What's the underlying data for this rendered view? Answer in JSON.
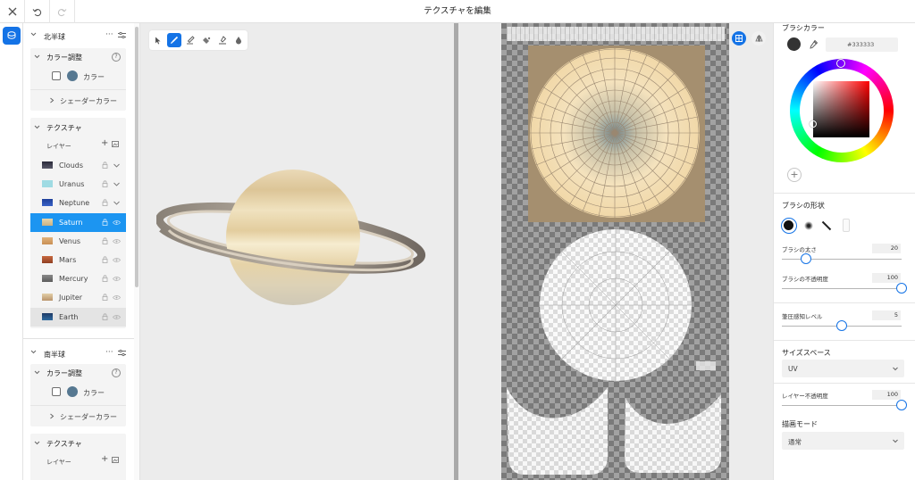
{
  "app": {
    "title": "テクスチャを編集"
  },
  "left": {
    "north": {
      "label": "北半球",
      "color_adjust": "カラー調整",
      "color_label": "カラー",
      "shader_color": "シェーダーカラー",
      "texture": "テクスチャ",
      "layer_label": "レイヤー",
      "layers": [
        "Clouds",
        "Uranus",
        "Neptune",
        "Saturn",
        "Venus",
        "Mars",
        "Mercury",
        "Jupiter",
        "Earth"
      ]
    },
    "south": {
      "label": "南半球",
      "color_adjust": "カラー調整",
      "color_label": "カラー",
      "shader_color": "シェーダーカラー",
      "texture": "テクスチャ",
      "layer_label": "レイヤー"
    },
    "swatch_color": "#567891",
    "selected_layer": "Saturn"
  },
  "right": {
    "brush_color_label": "ブラシカラー",
    "hex": "#333333",
    "brush_shape_label": "ブラシの形状",
    "brush_size_label": "ブラシの太さ",
    "brush_size": "20",
    "brush_opacity_label": "ブラシの不透明度",
    "brush_opacity": "100",
    "pressure_label": "筆圧感知レベル",
    "pressure": "5",
    "size_space_label": "サイズスペース",
    "size_space": "UV",
    "layer_opacity_label": "レイヤー不透明度",
    "layer_opacity": "100",
    "draw_mode_label": "描画モード",
    "draw_mode": "通常",
    "brush_size_fraction": 0.2,
    "brush_opacity_fraction": 1.0,
    "pressure_fraction": 0.5,
    "layer_opacity_fraction": 1.0
  },
  "colors": {
    "accent": "#1473e6",
    "selected_row": "#1c95f1",
    "brush": "#333333"
  }
}
